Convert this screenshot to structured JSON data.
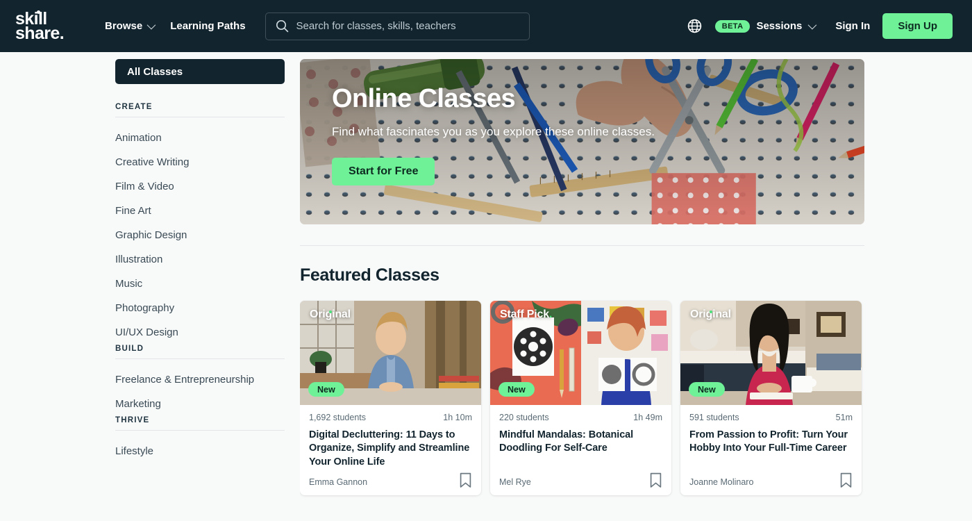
{
  "header": {
    "logo": {
      "line1": "skill",
      "line2": "share.",
      "icon": "skillshare-logo"
    },
    "nav": [
      {
        "label": "Browse",
        "has_chevron": true,
        "name": "browse"
      },
      {
        "label": "Learning Paths",
        "has_chevron": false,
        "name": "learning-paths"
      }
    ],
    "search": {
      "placeholder": "Search for classes, skills, teachers",
      "value": "",
      "icon": "search-icon"
    },
    "globe_icon": "globe-icon",
    "beta_badge": "BETA",
    "sessions_label": "Sessions",
    "sign_in": "Sign In",
    "sign_up": "Sign Up",
    "bg_color": "#12242E",
    "accent_green": "#6FF198"
  },
  "sidebar": {
    "active_item": "All Classes",
    "groups": [
      {
        "title": "CREATE",
        "items": [
          "Animation",
          "Creative Writing",
          "Film & Video",
          "Fine Art",
          "Graphic Design",
          "Illustration",
          "Music",
          "Photography",
          "UI/UX Design"
        ]
      },
      {
        "title": "BUILD",
        "items": [
          "Freelance & Entrepreneurship",
          "Marketing"
        ]
      },
      {
        "title": "THRIVE",
        "items": [
          "Lifestyle"
        ]
      }
    ]
  },
  "hero": {
    "title": "Online Classes",
    "subtitle": "Find what fascinates you as you explore these online classes.",
    "cta_label": "Start for Free",
    "image_description": "pegboard with scissors, colored pencils and craft tools"
  },
  "main": {
    "section_title": "Featured Classes"
  },
  "cards": [
    {
      "badge": "Original",
      "badge_style": "original",
      "new_badge": "New",
      "students": "1,692 students",
      "duration": "1h 10m",
      "title": "Digital Decluttering: 11 Days to Organize, Simplify and Streamline Your Online Life",
      "author": "Emma Gannon",
      "bookmark_icon": "bookmark-icon"
    },
    {
      "badge": "Staff Pick.",
      "badge_style": "staff-pick",
      "new_badge": "New",
      "students": "220 students",
      "duration": "1h 49m",
      "title": "Mindful Mandalas: Botanical Doodling For Self-Care",
      "author": "Mel Rye",
      "bookmark_icon": "bookmark-icon"
    },
    {
      "badge": "Original",
      "badge_style": "original",
      "new_badge": "New",
      "students": "591 students",
      "duration": "51m",
      "title": "From Passion to Profit: Turn Your Hobby Into Your Full-Time Career",
      "author": "Joanne Molinaro",
      "bookmark_icon": "bookmark-icon"
    }
  ]
}
